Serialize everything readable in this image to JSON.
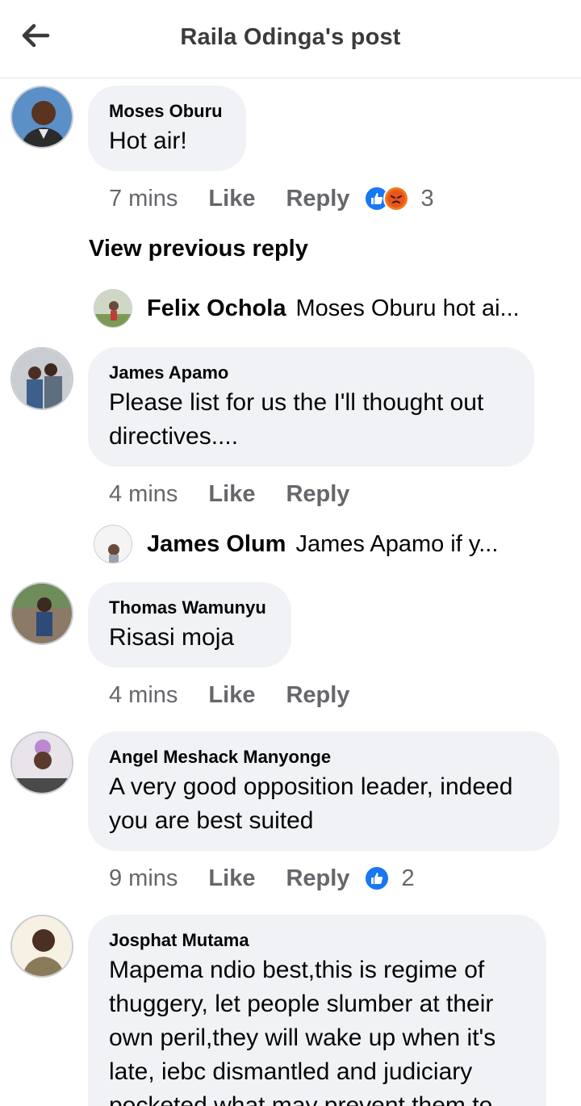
{
  "header": {
    "title": "Raila Odinga's post",
    "back_icon": "arrow-left-icon"
  },
  "colors": {
    "bubble": "#f0f2f5",
    "meta_text": "#65676b",
    "like_blue": "#1877f2",
    "angry_orange": "#f07a1a"
  },
  "comments": [
    {
      "author": "Moses Oburu",
      "text": "Hot air!",
      "time": "7 mins",
      "like_label": "Like",
      "reply_label": "Reply",
      "reactions": [
        "like",
        "angry"
      ],
      "reaction_count": "3"
    },
    {
      "author": "James Apamo",
      "text": "Please list for us the I'll thought out directives....",
      "time": "4 mins",
      "like_label": "Like",
      "reply_label": "Reply"
    },
    {
      "author": "Thomas Wamunyu",
      "text": "Risasi moja",
      "time": "4 mins",
      "like_label": "Like",
      "reply_label": "Reply"
    },
    {
      "author": "Angel Meshack Manyonge",
      "text": "A very good opposition leader, indeed you are best suited",
      "time": "9 mins",
      "like_label": "Like",
      "reply_label": "Reply",
      "reactions": [
        "like"
      ],
      "reaction_count": "2"
    },
    {
      "author": "Josphat Mutama",
      "text": "Mapema ndio best,this is regime of thuggery, let people slumber at their own peril,they will wake up when it's late, iebc dismantled and judiciary pocketed what may prevent them to"
    }
  ],
  "view_previous_reply": "View previous reply",
  "replies": [
    {
      "author": "Felix Ochola",
      "text": "Moses Oburu hot ai..."
    },
    {
      "author": "James Olum",
      "text": "James Apamo if y..."
    }
  ]
}
